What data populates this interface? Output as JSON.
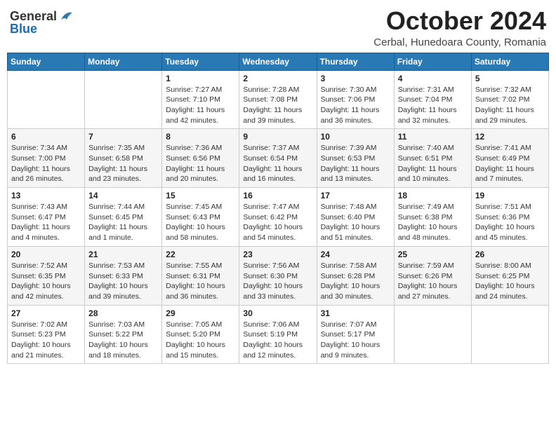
{
  "logo": {
    "general": "General",
    "blue": "Blue"
  },
  "title": "October 2024",
  "location": "Cerbal, Hunedoara County, Romania",
  "weekdays": [
    "Sunday",
    "Monday",
    "Tuesday",
    "Wednesday",
    "Thursday",
    "Friday",
    "Saturday"
  ],
  "weeks": [
    [
      {
        "day": "",
        "info": ""
      },
      {
        "day": "",
        "info": ""
      },
      {
        "day": "1",
        "info": "Sunrise: 7:27 AM\nSunset: 7:10 PM\nDaylight: 11 hours and 42 minutes."
      },
      {
        "day": "2",
        "info": "Sunrise: 7:28 AM\nSunset: 7:08 PM\nDaylight: 11 hours and 39 minutes."
      },
      {
        "day": "3",
        "info": "Sunrise: 7:30 AM\nSunset: 7:06 PM\nDaylight: 11 hours and 36 minutes."
      },
      {
        "day": "4",
        "info": "Sunrise: 7:31 AM\nSunset: 7:04 PM\nDaylight: 11 hours and 32 minutes."
      },
      {
        "day": "5",
        "info": "Sunrise: 7:32 AM\nSunset: 7:02 PM\nDaylight: 11 hours and 29 minutes."
      }
    ],
    [
      {
        "day": "6",
        "info": "Sunrise: 7:34 AM\nSunset: 7:00 PM\nDaylight: 11 hours and 26 minutes."
      },
      {
        "day": "7",
        "info": "Sunrise: 7:35 AM\nSunset: 6:58 PM\nDaylight: 11 hours and 23 minutes."
      },
      {
        "day": "8",
        "info": "Sunrise: 7:36 AM\nSunset: 6:56 PM\nDaylight: 11 hours and 20 minutes."
      },
      {
        "day": "9",
        "info": "Sunrise: 7:37 AM\nSunset: 6:54 PM\nDaylight: 11 hours and 16 minutes."
      },
      {
        "day": "10",
        "info": "Sunrise: 7:39 AM\nSunset: 6:53 PM\nDaylight: 11 hours and 13 minutes."
      },
      {
        "day": "11",
        "info": "Sunrise: 7:40 AM\nSunset: 6:51 PM\nDaylight: 11 hours and 10 minutes."
      },
      {
        "day": "12",
        "info": "Sunrise: 7:41 AM\nSunset: 6:49 PM\nDaylight: 11 hours and 7 minutes."
      }
    ],
    [
      {
        "day": "13",
        "info": "Sunrise: 7:43 AM\nSunset: 6:47 PM\nDaylight: 11 hours and 4 minutes."
      },
      {
        "day": "14",
        "info": "Sunrise: 7:44 AM\nSunset: 6:45 PM\nDaylight: 11 hours and 1 minute."
      },
      {
        "day": "15",
        "info": "Sunrise: 7:45 AM\nSunset: 6:43 PM\nDaylight: 10 hours and 58 minutes."
      },
      {
        "day": "16",
        "info": "Sunrise: 7:47 AM\nSunset: 6:42 PM\nDaylight: 10 hours and 54 minutes."
      },
      {
        "day": "17",
        "info": "Sunrise: 7:48 AM\nSunset: 6:40 PM\nDaylight: 10 hours and 51 minutes."
      },
      {
        "day": "18",
        "info": "Sunrise: 7:49 AM\nSunset: 6:38 PM\nDaylight: 10 hours and 48 minutes."
      },
      {
        "day": "19",
        "info": "Sunrise: 7:51 AM\nSunset: 6:36 PM\nDaylight: 10 hours and 45 minutes."
      }
    ],
    [
      {
        "day": "20",
        "info": "Sunrise: 7:52 AM\nSunset: 6:35 PM\nDaylight: 10 hours and 42 minutes."
      },
      {
        "day": "21",
        "info": "Sunrise: 7:53 AM\nSunset: 6:33 PM\nDaylight: 10 hours and 39 minutes."
      },
      {
        "day": "22",
        "info": "Sunrise: 7:55 AM\nSunset: 6:31 PM\nDaylight: 10 hours and 36 minutes."
      },
      {
        "day": "23",
        "info": "Sunrise: 7:56 AM\nSunset: 6:30 PM\nDaylight: 10 hours and 33 minutes."
      },
      {
        "day": "24",
        "info": "Sunrise: 7:58 AM\nSunset: 6:28 PM\nDaylight: 10 hours and 30 minutes."
      },
      {
        "day": "25",
        "info": "Sunrise: 7:59 AM\nSunset: 6:26 PM\nDaylight: 10 hours and 27 minutes."
      },
      {
        "day": "26",
        "info": "Sunrise: 8:00 AM\nSunset: 6:25 PM\nDaylight: 10 hours and 24 minutes."
      }
    ],
    [
      {
        "day": "27",
        "info": "Sunrise: 7:02 AM\nSunset: 5:23 PM\nDaylight: 10 hours and 21 minutes."
      },
      {
        "day": "28",
        "info": "Sunrise: 7:03 AM\nSunset: 5:22 PM\nDaylight: 10 hours and 18 minutes."
      },
      {
        "day": "29",
        "info": "Sunrise: 7:05 AM\nSunset: 5:20 PM\nDaylight: 10 hours and 15 minutes."
      },
      {
        "day": "30",
        "info": "Sunrise: 7:06 AM\nSunset: 5:19 PM\nDaylight: 10 hours and 12 minutes."
      },
      {
        "day": "31",
        "info": "Sunrise: 7:07 AM\nSunset: 5:17 PM\nDaylight: 10 hours and 9 minutes."
      },
      {
        "day": "",
        "info": ""
      },
      {
        "day": "",
        "info": ""
      }
    ]
  ]
}
